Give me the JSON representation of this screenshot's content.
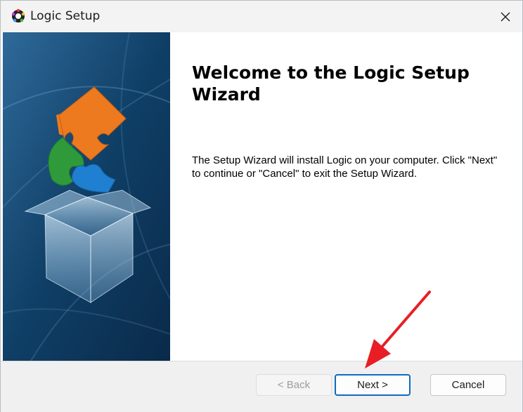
{
  "window": {
    "title": "Logic Setup",
    "icon": "logic-app-icon"
  },
  "content": {
    "heading": "Welcome to the Logic Setup Wizard",
    "description": "The Setup Wizard will install Logic on your computer.  Click \"Next\" to continue or \"Cancel\" to exit the Setup Wizard."
  },
  "buttons": {
    "back": "< Back",
    "next": "Next >",
    "cancel": "Cancel"
  },
  "colors": {
    "banner_dark": "#0a2a4a",
    "banner_light": "#2f6a9a",
    "puzzle_orange": "#ee7a1f",
    "puzzle_green": "#2f9a3a",
    "puzzle_blue": "#1f7fd0",
    "annotation_arrow": "#e81e24",
    "accent": "#0f6cbd"
  }
}
